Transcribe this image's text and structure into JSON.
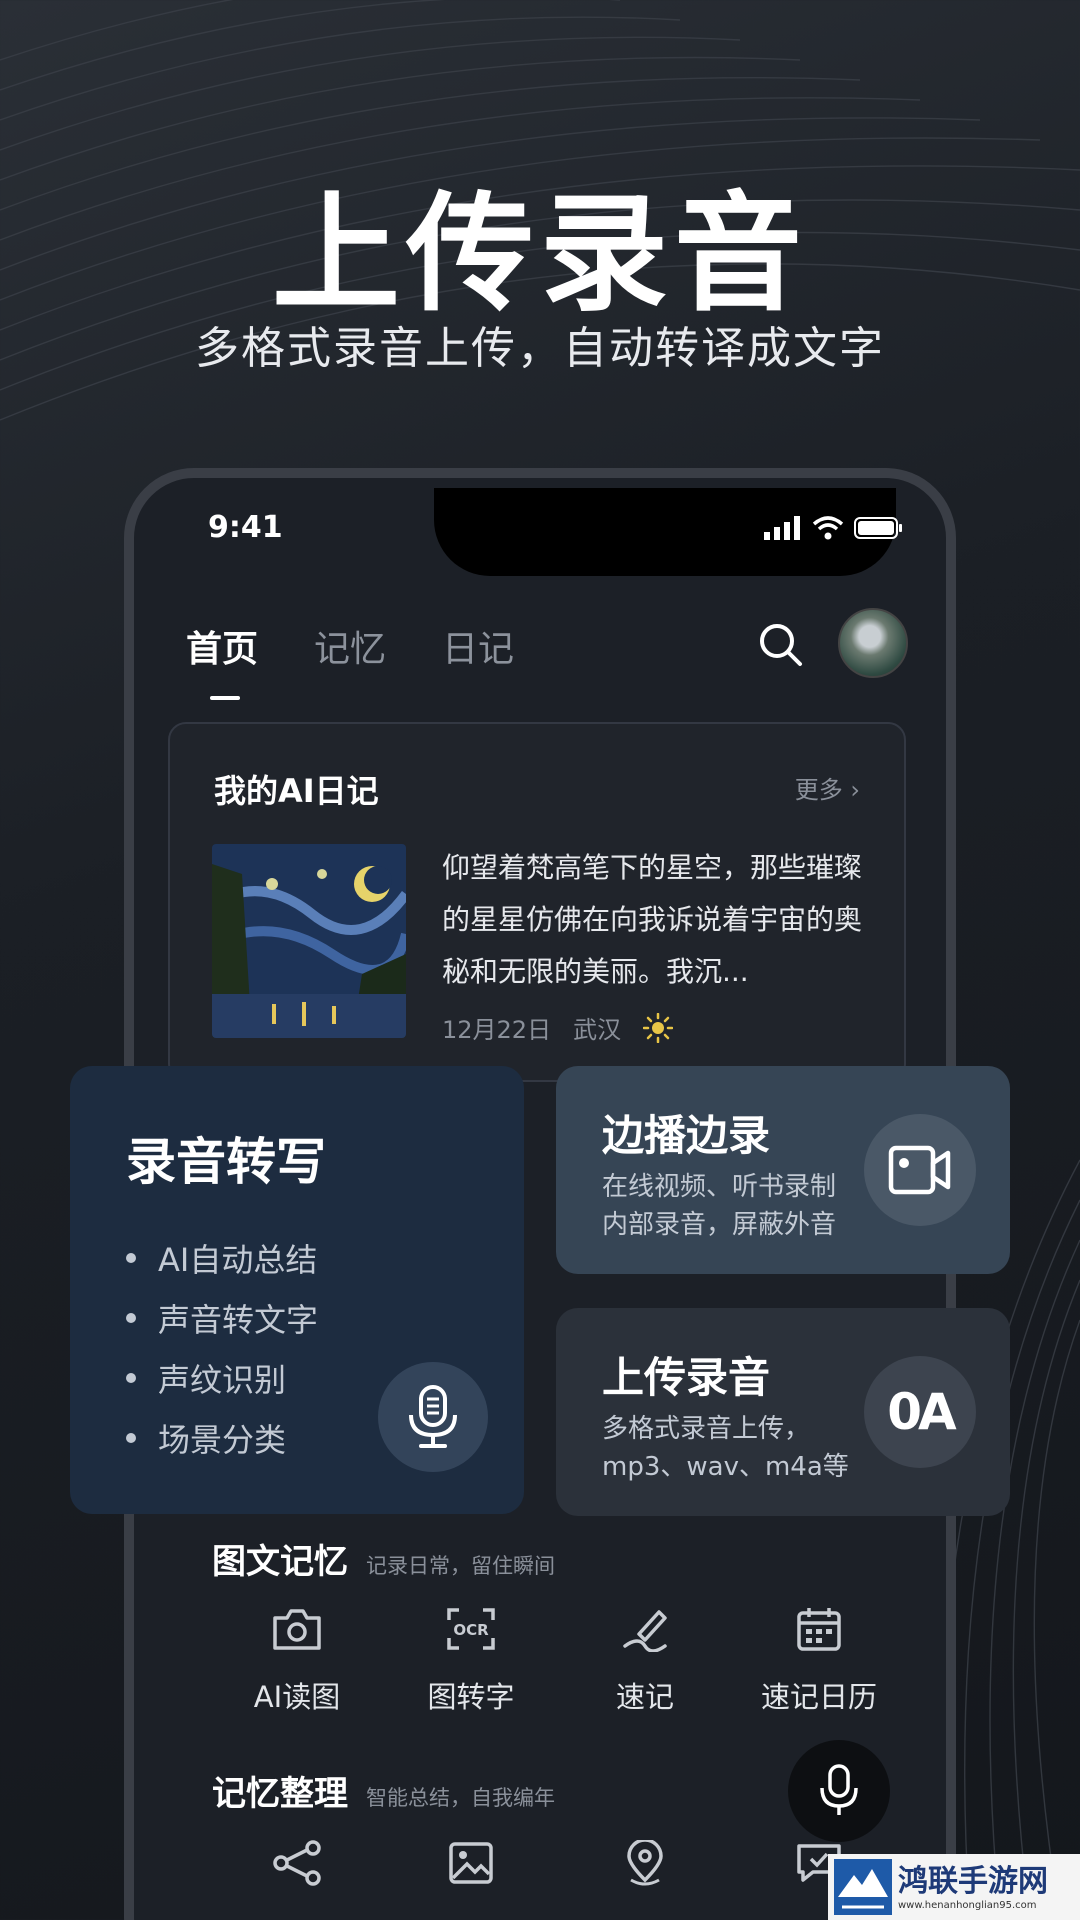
{
  "hero": {
    "title": "上传录音",
    "subtitle": "多格式录音上传，自动转译成文字"
  },
  "status_bar": {
    "time": "9:41"
  },
  "nav": {
    "tabs": [
      "首页",
      "记忆",
      "日记"
    ],
    "active_tab": "首页"
  },
  "diary": {
    "title": "我的AI日记",
    "more": "更多 ›",
    "text": "仰望着梵高笔下的星空，那些璀璨的星星仿佛在向我诉说着宇宙的奥秘和无限的美丽。我沉...",
    "date": "12月22日",
    "location": "武汉",
    "weather_icon": "sun-icon"
  },
  "transcribe_card": {
    "title": "录音转写",
    "features": [
      "AI自动总结",
      "声音转文字",
      "声纹识别",
      "场景分类"
    ]
  },
  "live_card": {
    "title": "边播边录",
    "desc_line1": "在线视频、听书录制",
    "desc_line2": "内部录音，屏蔽外音"
  },
  "upload_card": {
    "title": "上传录音",
    "desc_line1": "多格式录音上传，",
    "desc_line2": "mp3、wav、m4a等",
    "icon_text": "0A"
  },
  "image_memory": {
    "title": "图文记忆",
    "hint": "记录日常，留住瞬间",
    "tools": [
      "AI读图",
      "图转字",
      "速记",
      "速记日历"
    ]
  },
  "memory_organize": {
    "title": "记忆整理",
    "hint": "智能总结，自我编年"
  },
  "watermark": {
    "text": "鸿联手游网",
    "url": "www.henanhonglian95.com"
  },
  "colors": {
    "background": "#1b1f25",
    "transcribe_card": "#1d2c40",
    "live_card": "#364555",
    "upload_card": "#2b313a"
  }
}
